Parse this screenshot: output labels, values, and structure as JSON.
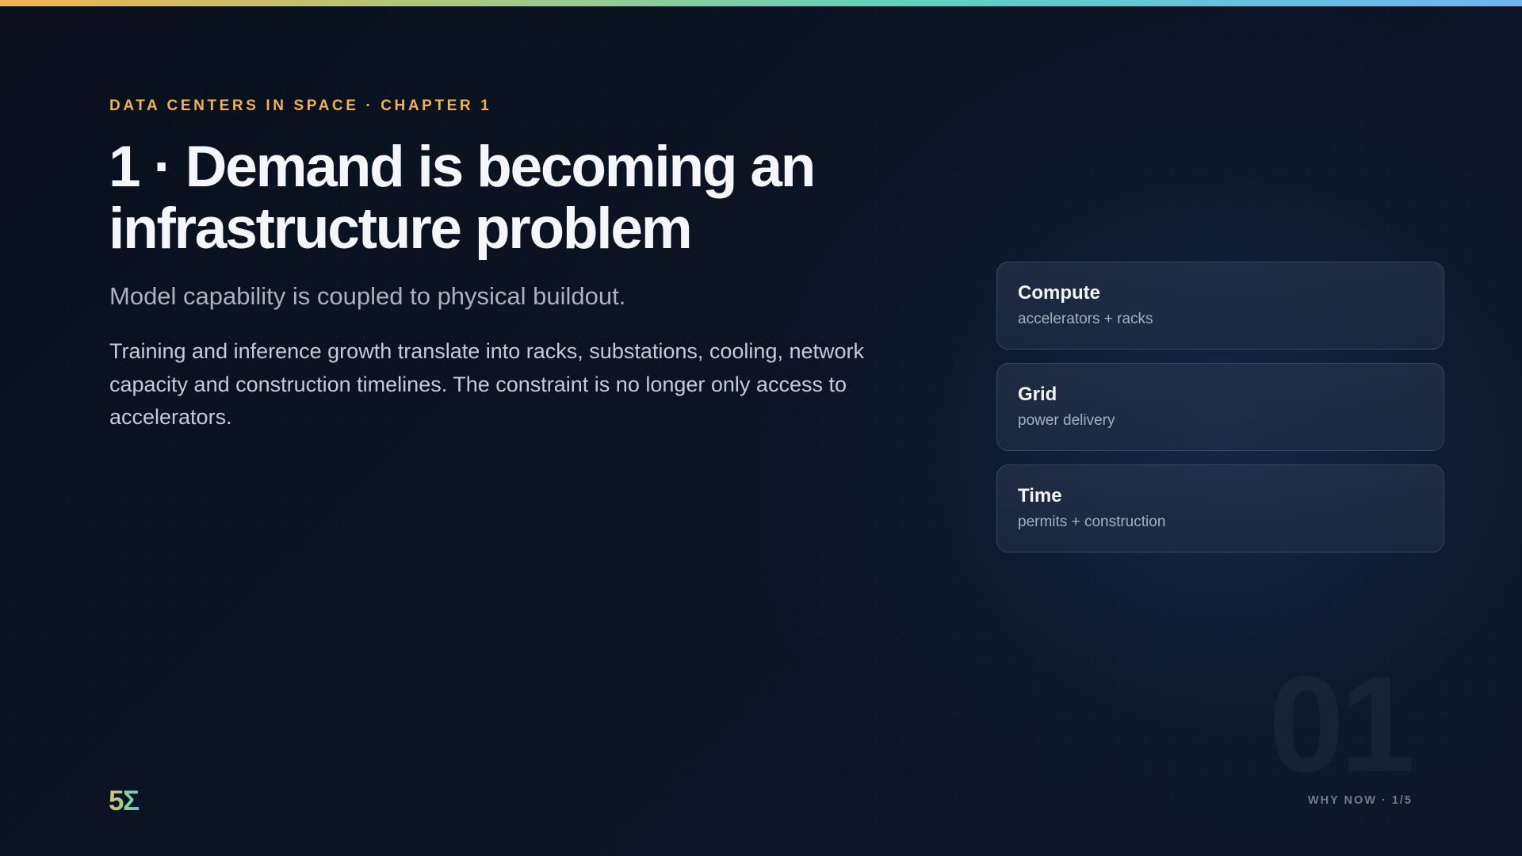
{
  "slide": {
    "eyebrow": "DATA CENTERS IN SPACE · CHAPTER 1",
    "title_line1": "1 · Demand is becoming an",
    "title_line2": "infrastructure problem",
    "subtitle": "Model capability is coupled to physical buildout.",
    "body": "Training and inference growth translate into racks, substations, cooling, network capacity and construction timelines. The constraint is no longer only access to accelerators.",
    "cards": [
      {
        "title": "Compute",
        "subtitle": "accelerators + racks"
      },
      {
        "title": "Grid",
        "subtitle": "power delivery"
      },
      {
        "title": "Time",
        "subtitle": "permits + construction"
      }
    ],
    "big_number": "01",
    "page_indicator": "WHY NOW · 1/5",
    "logo": "5Σ"
  },
  "colors": {
    "background": "#0b1220",
    "accent_eyebrow": "#f2b24c",
    "top_bar_gradient": [
      "#f4b350",
      "#a9c97e",
      "#5fd1c0",
      "#6fb6f6"
    ],
    "logo_gradient": [
      "#d8c46a",
      "#5fd1c0"
    ]
  }
}
